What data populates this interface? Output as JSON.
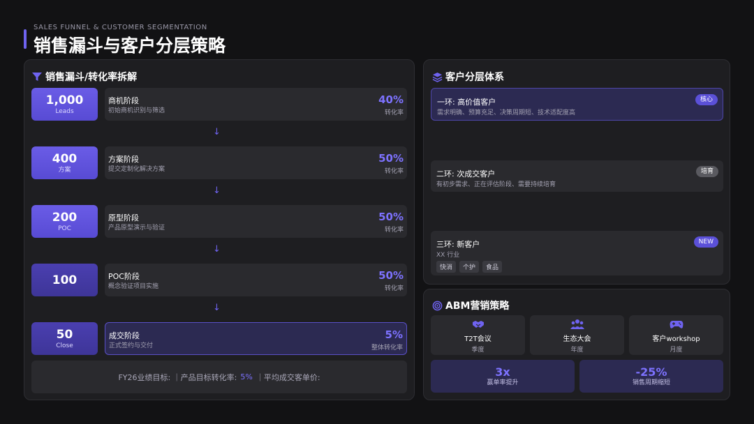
{
  "header": {
    "subtitle": "SALES FUNNEL & CUSTOMER SEGMENTATION",
    "title": "销售漏斗与客户分层策略"
  },
  "funnel": {
    "title": "销售漏斗/转化率拆解",
    "stages": [
      {
        "count": "1,000",
        "unit": "Leads",
        "name": "商机阶段",
        "desc": "初始商机识别与筛选",
        "rate": "40%",
        "rate_label": "转化率"
      },
      {
        "count": "400",
        "unit": "方案",
        "name": "方案阶段",
        "desc": "提交定制化解决方案",
        "rate": "50%",
        "rate_label": "转化率"
      },
      {
        "count": "200",
        "unit": "POC",
        "name": "原型阶段",
        "desc": "产品原型演示与验证",
        "rate": "50%",
        "rate_label": "转化率"
      },
      {
        "count": "100",
        "unit": "",
        "name": "POC阶段",
        "desc": "概念验证项目实施",
        "rate": "50%",
        "rate_label": "转化率"
      },
      {
        "count": "50",
        "unit": "Close",
        "name": "成交阶段",
        "desc": "正式签约与交付",
        "rate": "5%",
        "rate_label": "整体转化率"
      }
    ],
    "arrow": "↓",
    "goals": {
      "prefix": "FY26业绩目标: ｜产品目标转化率:",
      "value": "5%",
      "suffix": "｜平均成交客单价:"
    }
  },
  "segmentation": {
    "title": "客户分层体系",
    "tiers": [
      {
        "name": "一环:  高价值客户",
        "desc": "需求明确、预算充足、决策周期短、技术适配度高",
        "badge": "核心"
      },
      {
        "name": "二环: 次成交客户",
        "desc": "有初步需求、正在评估阶段、需要持续培育",
        "badge": "培育"
      },
      {
        "name": "三环: 新客户",
        "desc": "XX 行业",
        "badge": "NEW",
        "tags": [
          "快消",
          "个护",
          "食品"
        ]
      }
    ]
  },
  "abm": {
    "title": "ABM营销策略",
    "activities": [
      {
        "icon": "handshake-icon",
        "name": "T2T会议",
        "freq": "季度"
      },
      {
        "icon": "people-icon",
        "name": "生态大会",
        "freq": "年度"
      },
      {
        "icon": "gamepad-icon",
        "name": "客户workshop",
        "freq": "月度"
      }
    ],
    "metrics": [
      {
        "value": "3x",
        "label": "赢单率提升"
      },
      {
        "value": "-25%",
        "label": "销售周期缩短"
      }
    ]
  },
  "colors": {
    "accent": "#6f63f0",
    "accent_text": "#7d72ff",
    "background": "#121214",
    "panel": "#1e1e21"
  }
}
